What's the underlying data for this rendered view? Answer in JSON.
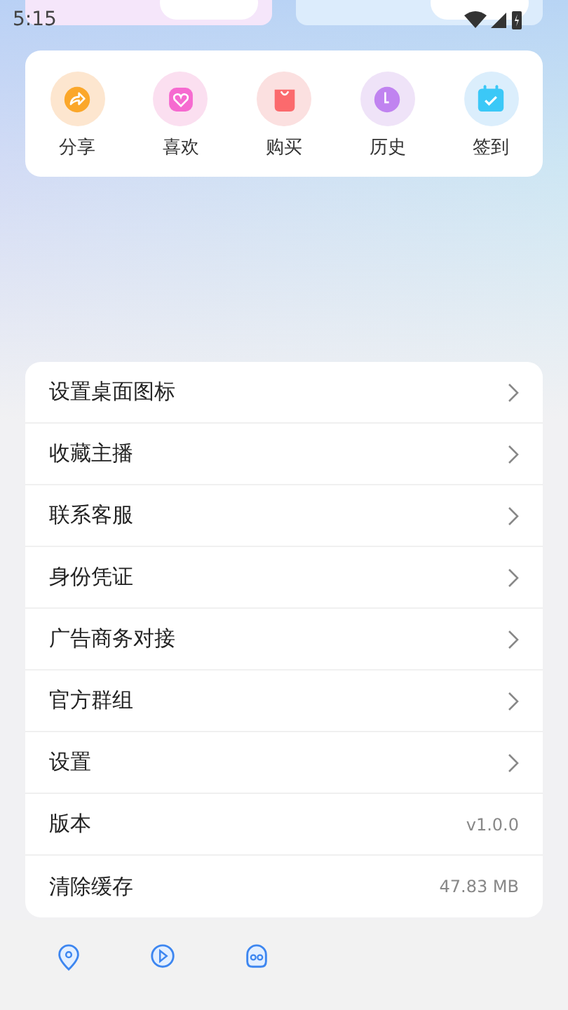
{
  "status_bar": {
    "time": "5:15"
  },
  "shortcuts": [
    {
      "label": "分享",
      "kind": "share"
    },
    {
      "label": "喜欢",
      "kind": "like"
    },
    {
      "label": "购买",
      "kind": "buy"
    },
    {
      "label": "历史",
      "kind": "history"
    },
    {
      "label": "签到",
      "kind": "checkin"
    }
  ],
  "menu": [
    {
      "label": "设置桌面图标",
      "kind": "link"
    },
    {
      "label": "收藏主播",
      "kind": "link"
    },
    {
      "label": "联系客服",
      "kind": "link"
    },
    {
      "label": "身份凭证",
      "kind": "link"
    },
    {
      "label": "广告商务对接",
      "kind": "link"
    },
    {
      "label": "官方群组",
      "kind": "link"
    },
    {
      "label": "设置",
      "kind": "link"
    },
    {
      "label": "版本",
      "kind": "value",
      "value": "v1.0.0"
    },
    {
      "label": "清除缓存",
      "kind": "value",
      "value": "47.83 MB"
    }
  ],
  "bottom_nav": [
    {
      "kind": "pin"
    },
    {
      "kind": "play"
    },
    {
      "kind": "face"
    }
  ]
}
